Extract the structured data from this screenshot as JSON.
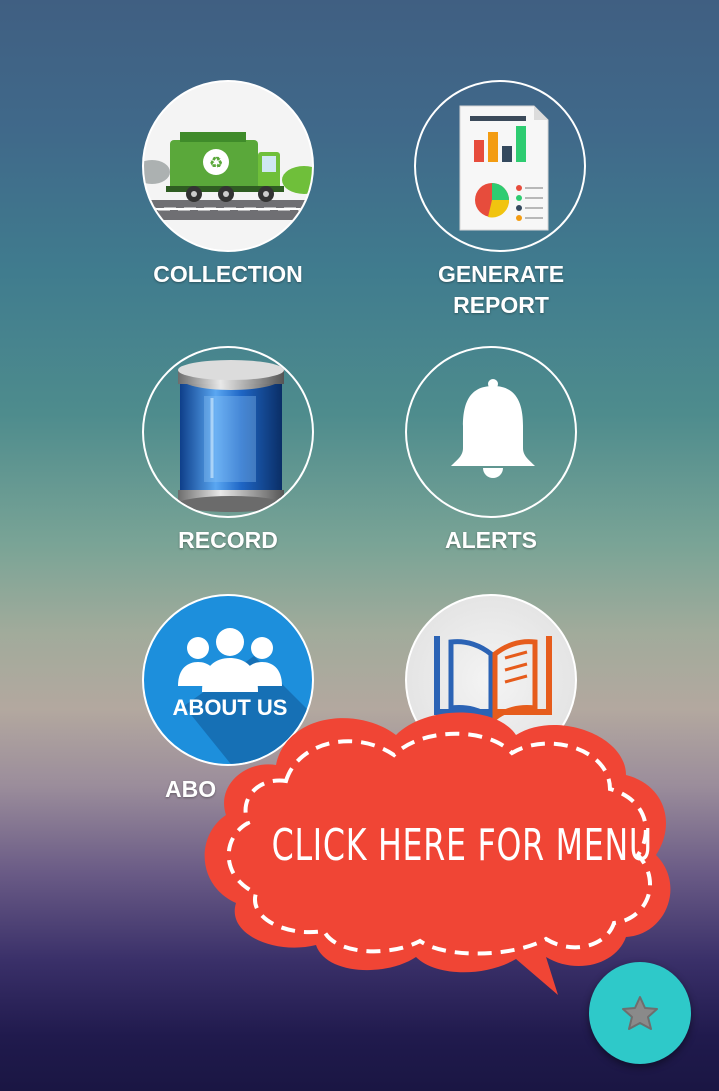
{
  "menu": {
    "tiles": [
      {
        "label": "COLLECTION",
        "icon": "garbage-truck-icon"
      },
      {
        "label": "GENERATE REPORT",
        "icon": "report-icon"
      },
      {
        "label": "RECORD",
        "icon": "database-icon"
      },
      {
        "label": "ALERTS",
        "icon": "bell-icon"
      },
      {
        "label": "ABO",
        "badge_text": "ABOUT US",
        "icon": "about-us-icon"
      },
      {
        "label": "",
        "icon": "open-book-icon"
      }
    ]
  },
  "callout": {
    "text": "CLICK HERE FOR MENU",
    "color": "#f04535"
  },
  "fab": {
    "icon": "star-icon",
    "color": "#2ec9c9"
  }
}
